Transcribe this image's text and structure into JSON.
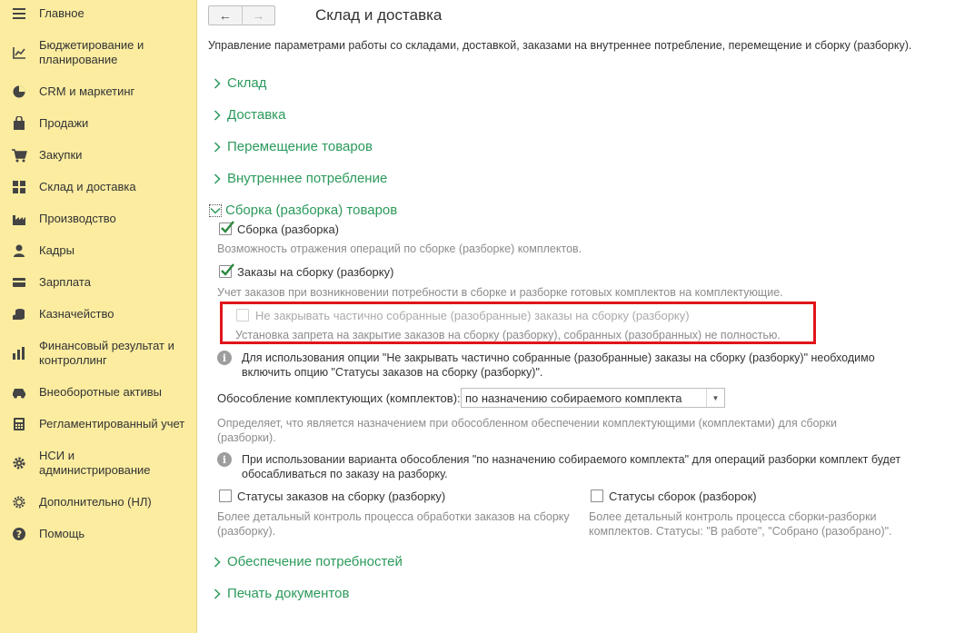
{
  "sidebar": {
    "items": [
      {
        "label": "Главное",
        "icon": "menu-icon"
      },
      {
        "label": "Бюджетирование и\nпланирование",
        "icon": "budget-chart-icon"
      },
      {
        "label": "CRM и маркетинг",
        "icon": "pie-icon"
      },
      {
        "label": "Продажи",
        "icon": "bag-icon"
      },
      {
        "label": "Закупки",
        "icon": "cart-icon"
      },
      {
        "label": "Склад и доставка",
        "icon": "grid-icon"
      },
      {
        "label": "Производство",
        "icon": "factory-icon"
      },
      {
        "label": "Кадры",
        "icon": "person-icon"
      },
      {
        "label": "Зарплата",
        "icon": "wallet-icon"
      },
      {
        "label": "Казначейство",
        "icon": "coins-icon"
      },
      {
        "label": "Финансовый результат и\nконтроллинг",
        "icon": "bar-chart-icon"
      },
      {
        "label": "Внеоборотные активы",
        "icon": "car-icon"
      },
      {
        "label": "Регламентированный учет",
        "icon": "calculator-icon"
      },
      {
        "label": "НСИ и\nадминистрирование",
        "icon": "gear-icon"
      },
      {
        "label": "Дополнительно (НЛ)",
        "icon": "gear-outline-icon"
      },
      {
        "label": "Помощь",
        "icon": "help-icon"
      }
    ]
  },
  "header": {
    "back_icon": "←",
    "forward_icon": "→",
    "title": "Склад и доставка",
    "description": "Управление параметрами работы со складами, доставкой, заказами на внутреннее потребление, перемещение и сборку (разборку)."
  },
  "sections": {
    "warehouse": "Склад",
    "delivery": "Доставка",
    "transfer": "Перемещение товаров",
    "internal": "Внутреннее потребление",
    "assembly": "Сборка (разборка) товаров",
    "needs": "Обеспечение потребностей",
    "print": "Печать документов"
  },
  "assembly": {
    "cb_assembly": {
      "label": "Сборка (разборка)",
      "checked": true
    },
    "hint_assembly": "Возможность отражения операций по сборке (разборке) комплектов.",
    "cb_orders": {
      "label": "Заказы на сборку (разборку)",
      "checked": true
    },
    "hint_orders": "Учет заказов при возникновении потребности в сборке и разборке готовых комплектов на комплектующие.",
    "cb_noclose": {
      "label": "Не закрывать частично собранные (разобранные) заказы на сборку (разборку)",
      "checked": false,
      "disabled": true
    },
    "hint_noclose": "Установка запрета на закрытие заказов на сборку (разборку), собранных (разобранных) не полностью.",
    "info1": "Для использования опции \"Не закрывать частично собранные (разобранные) заказы на сборку (разборку)\" необходимо\nвключить опцию \"Статусы заказов на сборку (разборку)\".",
    "isolation_label": "Обособление комплектующих (комплектов):",
    "isolation_value": "по назначению собираемого комплекта",
    "hint_isolation": "Определяет, что является назначением при обособленном обеспечении комплектующими (комплектами) для сборки\n(разборки).",
    "info2": "При использовании варианта обособления \"по назначению собираемого комплекта\" для операций разборки комплект будет\nобосабливаться по заказу на разборку.",
    "cb_order_status": {
      "label": "Статусы заказов на сборку (разборку)",
      "checked": false
    },
    "hint_order_status": "Более детальный контроль процесса обработки заказов на сборку\n(разборку).",
    "cb_assembly_status": {
      "label": "Статусы сборок (разборок)",
      "checked": false
    },
    "hint_assembly_status": "Более детальный контроль процесса сборки-разборки\nкомплектов. Статусы: \"В работе\", \"Собрано (разобрано)\"."
  },
  "colors": {
    "sidebar_bg": "#fbeca0",
    "section_green": "#2b9a5b",
    "highlight_red": "#e0151b",
    "check_green": "#2b8a3e"
  }
}
